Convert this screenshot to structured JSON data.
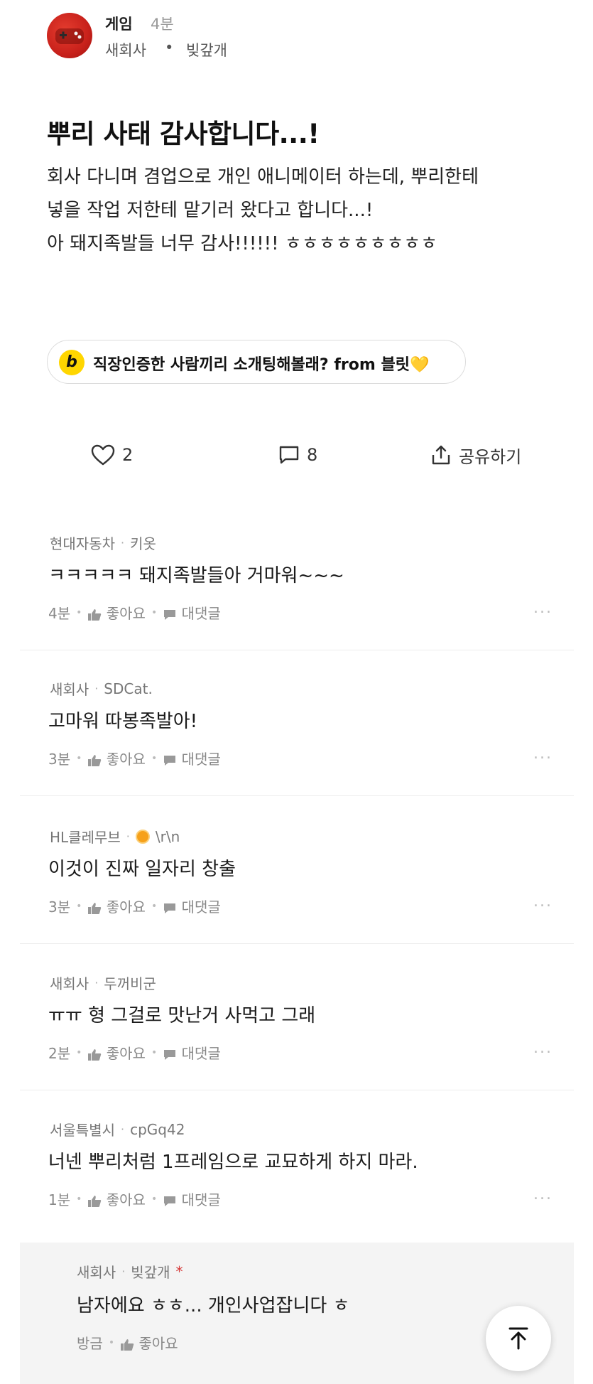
{
  "post": {
    "category": "게임",
    "time": "4분",
    "company": "새회사",
    "separator": "•",
    "nickname": "빚갚개",
    "title": "뿌리 사태 감사합니다...!",
    "body_lines": [
      "회사 다니며 겸업으로 개인 애니메이터 하는데, 뿌리한테",
      "넣을 작업 저한테 맡기러 왔다고 합니다...!",
      "아 돼지족발들 너무 감사!!!!!! ㅎㅎㅎㅎㅎㅎㅎㅎㅎ"
    ]
  },
  "ad": {
    "icon_letter": "b",
    "text": "직장인증한 사람끼리 소개팅해볼래? from 블릿",
    "emoji": "💛"
  },
  "actions": {
    "like_count": "2",
    "comment_count": "8",
    "share_label": "공유하기"
  },
  "comments": [
    {
      "company": "현대자동차",
      "nickname": "키옷",
      "text": "ㅋㅋㅋㅋㅋ 돼지족발들아 거마워~~~",
      "time": "4분",
      "like_label": "좋아요",
      "reply_label": "대댓글",
      "more": "..."
    },
    {
      "company": "새회사",
      "nickname": "SDCat.",
      "text": "고마워 따봉족발아!",
      "time": "3분",
      "like_label": "좋아요",
      "reply_label": "대댓글",
      "more": "..."
    },
    {
      "company": "HL클레무브",
      "nickname": "\\r\\n",
      "text": "이것이 진짜 일자리 창출",
      "time": "3분",
      "like_label": "좋아요",
      "reply_label": "대댓글",
      "more": "..."
    },
    {
      "company": "새회사",
      "nickname": "두꺼비군",
      "text": "ㅠㅠ 형 그걸로 맛난거 사먹고 그래",
      "time": "2분",
      "like_label": "좋아요",
      "reply_label": "대댓글",
      "more": "..."
    },
    {
      "company": "서울특별시",
      "nickname": "cpGq42",
      "text": "너넨 뿌리처럼 1프레임으로 교묘하게 하지 마라.",
      "time": "1분",
      "like_label": "좋아요",
      "reply_label": "대댓글",
      "more": "..."
    }
  ],
  "reply": {
    "company": "새회사",
    "nickname": "빚갚개",
    "author_mark": "*",
    "text": "남자에요 ㅎㅎ... 개인사업잡니다 ㅎ",
    "time": "방금",
    "like_label": "좋아요"
  },
  "colors": {
    "accent_yellow": "#ffd600",
    "author_star": "#d63a3a",
    "avatar_red": "#c8211b"
  },
  "icons": {
    "like": "heart-icon",
    "comment": "speech-bubble-icon",
    "share": "share-icon",
    "scroll_top": "arrow-up-icon"
  }
}
